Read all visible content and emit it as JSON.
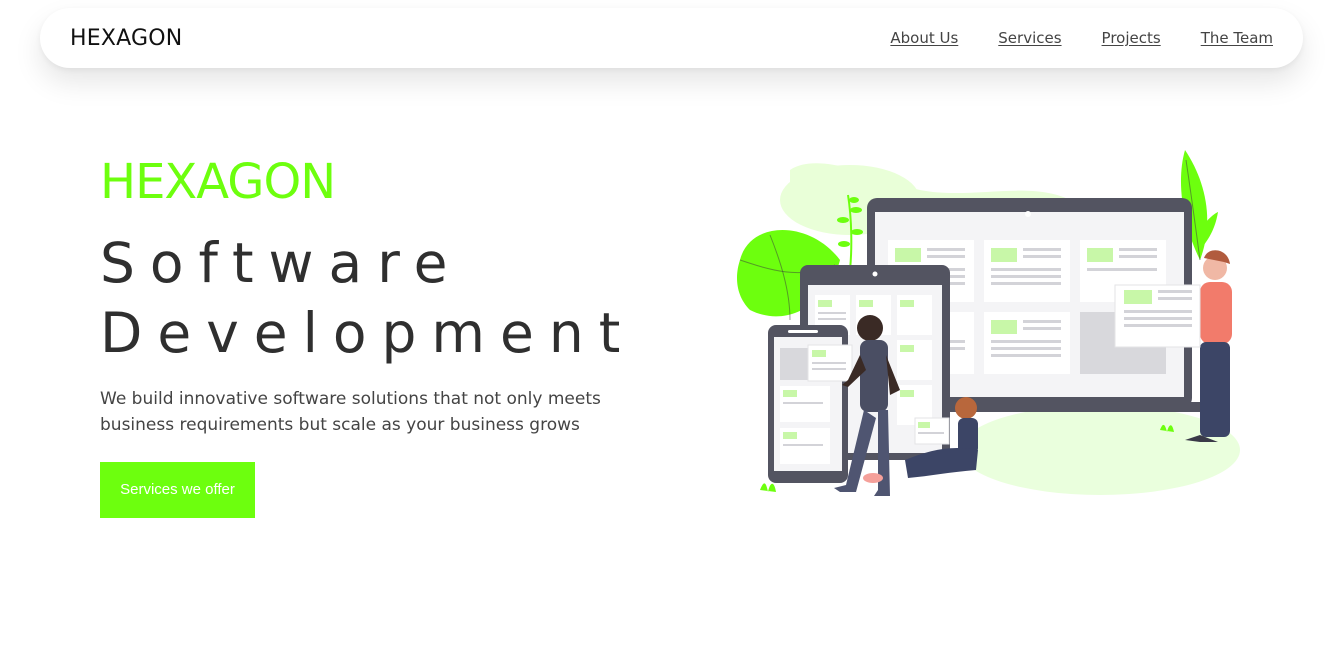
{
  "navbar": {
    "brand": "HEXAGON",
    "links": [
      "About Us",
      "Services",
      "Projects",
      "The Team"
    ]
  },
  "hero": {
    "brand": "HEXAGON",
    "title_line1": "Software",
    "title_line2": "Development",
    "description": "We build innovative software solutions that not only meets business requirements but scale as your business grows",
    "cta_label": "Services we offer"
  },
  "colors": {
    "accent": "#6dff0e",
    "text_dark": "#2f2f2f",
    "device_frame": "#535461",
    "person_shirt": "#f27b6b"
  },
  "illustration": {
    "icon": "people-with-devices-illustration"
  }
}
